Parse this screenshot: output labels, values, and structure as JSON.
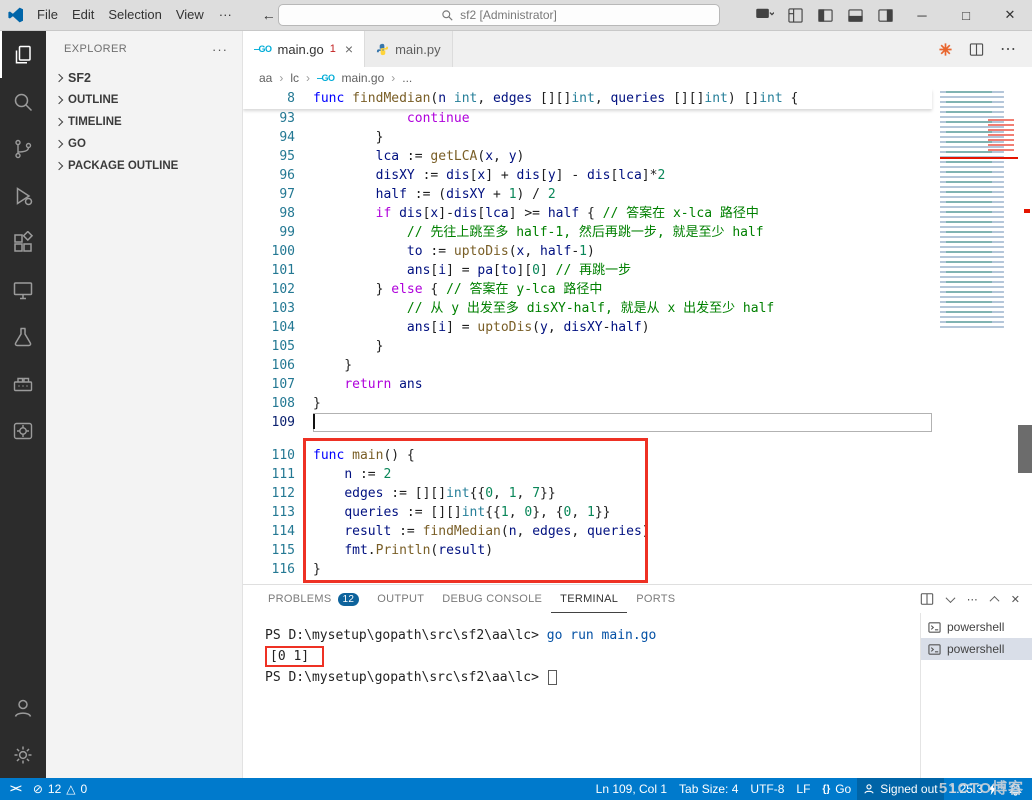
{
  "titlebar": {
    "menus": [
      "File",
      "Edit",
      "Selection",
      "View"
    ],
    "overflow": "···",
    "back": "←",
    "forward": "→",
    "search_label": "sf2 [Administrator]",
    "minimize": "─",
    "maximize": "□",
    "close": "✕"
  },
  "sidebar": {
    "title": "EXPLORER",
    "more": "···",
    "sections": [
      "SF2",
      "OUTLINE",
      "TIMELINE",
      "GO",
      "PACKAGE OUTLINE"
    ]
  },
  "tabs": {
    "tab1": {
      "label": "main.go",
      "badge": "1",
      "close": "×"
    },
    "tab2": {
      "label": "main.py"
    },
    "more": "⋯"
  },
  "breadcrumb": {
    "items": [
      "aa",
      "lc",
      "main.go"
    ],
    "sep": "›",
    "more": "..."
  },
  "editor": {
    "sticky": {
      "num": "8",
      "tokens": [
        [
          "k",
          "func "
        ],
        [
          "f",
          "findMedian"
        ],
        [
          "d",
          "("
        ],
        [
          "v",
          "n"
        ],
        [
          "t",
          " int"
        ],
        [
          "d",
          ", "
        ],
        [
          "v",
          "edges"
        ],
        [
          "d",
          " [][]"
        ],
        [
          "t",
          "int"
        ],
        [
          "d",
          ", "
        ],
        [
          "v",
          "queries"
        ],
        [
          "d",
          " [][]"
        ],
        [
          "t",
          "int"
        ],
        [
          "d",
          ") []"
        ],
        [
          "t",
          "int"
        ],
        [
          "d",
          " {"
        ]
      ]
    },
    "lines": [
      {
        "num": "93",
        "tokens": [
          [
            "d",
            "            "
          ],
          [
            "c",
            "continue"
          ]
        ]
      },
      {
        "num": "94",
        "tokens": [
          [
            "d",
            "        }"
          ]
        ]
      },
      {
        "num": "95",
        "tokens": [
          [
            "d",
            "        "
          ],
          [
            "v",
            "lca"
          ],
          [
            "d",
            " := "
          ],
          [
            "f",
            "getLCA"
          ],
          [
            "d",
            "("
          ],
          [
            "v",
            "x"
          ],
          [
            "d",
            ", "
          ],
          [
            "v",
            "y"
          ],
          [
            "d",
            ")"
          ]
        ]
      },
      {
        "num": "96",
        "tokens": [
          [
            "d",
            "        "
          ],
          [
            "v",
            "disXY"
          ],
          [
            "d",
            " := "
          ],
          [
            "v",
            "dis"
          ],
          [
            "d",
            "["
          ],
          [
            "v",
            "x"
          ],
          [
            "d",
            "] + "
          ],
          [
            "v",
            "dis"
          ],
          [
            "d",
            "["
          ],
          [
            "v",
            "y"
          ],
          [
            "d",
            "] - "
          ],
          [
            "v",
            "dis"
          ],
          [
            "d",
            "["
          ],
          [
            "v",
            "lca"
          ],
          [
            "d",
            "]*"
          ],
          [
            "n",
            "2"
          ]
        ]
      },
      {
        "num": "97",
        "tokens": [
          [
            "d",
            "        "
          ],
          [
            "v",
            "half"
          ],
          [
            "d",
            " := ("
          ],
          [
            "v",
            "disXY"
          ],
          [
            "d",
            " + "
          ],
          [
            "n",
            "1"
          ],
          [
            "d",
            ") / "
          ],
          [
            "n",
            "2"
          ]
        ]
      },
      {
        "num": "98",
        "tokens": [
          [
            "d",
            "        "
          ],
          [
            "c",
            "if"
          ],
          [
            "d",
            " "
          ],
          [
            "v",
            "dis"
          ],
          [
            "d",
            "["
          ],
          [
            "v",
            "x"
          ],
          [
            "d",
            "]-"
          ],
          [
            "v",
            "dis"
          ],
          [
            "d",
            "["
          ],
          [
            "v",
            "lca"
          ],
          [
            "d",
            "] >= "
          ],
          [
            "v",
            "half"
          ],
          [
            "d",
            " { "
          ],
          [
            "m",
            "// 答案在 x-lca 路径中"
          ]
        ]
      },
      {
        "num": "99",
        "tokens": [
          [
            "d",
            "            "
          ],
          [
            "m",
            "// 先往上跳至多 half-1, 然后再跳一步, 就是至少 half"
          ]
        ]
      },
      {
        "num": "100",
        "tokens": [
          [
            "d",
            "            "
          ],
          [
            "v",
            "to"
          ],
          [
            "d",
            " := "
          ],
          [
            "f",
            "uptoDis"
          ],
          [
            "d",
            "("
          ],
          [
            "v",
            "x"
          ],
          [
            "d",
            ", "
          ],
          [
            "v",
            "half"
          ],
          [
            "d",
            "-"
          ],
          [
            "n",
            "1"
          ],
          [
            "d",
            ")"
          ]
        ]
      },
      {
        "num": "101",
        "tokens": [
          [
            "d",
            "            "
          ],
          [
            "v",
            "ans"
          ],
          [
            "d",
            "["
          ],
          [
            "v",
            "i"
          ],
          [
            "d",
            "] = "
          ],
          [
            "v",
            "pa"
          ],
          [
            "d",
            "["
          ],
          [
            "v",
            "to"
          ],
          [
            "d",
            "]["
          ],
          [
            "n",
            "0"
          ],
          [
            "d",
            "] "
          ],
          [
            "m",
            "// 再跳一步"
          ]
        ]
      },
      {
        "num": "102",
        "tokens": [
          [
            "d",
            "        } "
          ],
          [
            "c",
            "else"
          ],
          [
            "d",
            " { "
          ],
          [
            "m",
            "// 答案在 y-lca 路径中"
          ]
        ]
      },
      {
        "num": "103",
        "tokens": [
          [
            "d",
            "            "
          ],
          [
            "m",
            "// 从 y 出发至多 disXY-half, 就是从 x 出发至少 half"
          ]
        ]
      },
      {
        "num": "104",
        "tokens": [
          [
            "d",
            "            "
          ],
          [
            "v",
            "ans"
          ],
          [
            "d",
            "["
          ],
          [
            "v",
            "i"
          ],
          [
            "d",
            "] = "
          ],
          [
            "f",
            "uptoDis"
          ],
          [
            "d",
            "("
          ],
          [
            "v",
            "y"
          ],
          [
            "d",
            ", "
          ],
          [
            "v",
            "disXY"
          ],
          [
            "d",
            "-"
          ],
          [
            "v",
            "half"
          ],
          [
            "d",
            ")"
          ]
        ]
      },
      {
        "num": "105",
        "tokens": [
          [
            "d",
            "        }"
          ]
        ]
      },
      {
        "num": "106",
        "tokens": [
          [
            "d",
            "    }"
          ]
        ]
      },
      {
        "num": "107",
        "tokens": [
          [
            "d",
            "    "
          ],
          [
            "c",
            "return"
          ],
          [
            "d",
            " "
          ],
          [
            "v",
            "ans"
          ]
        ]
      },
      {
        "num": "108",
        "tokens": [
          [
            "d",
            "}"
          ]
        ]
      },
      {
        "num": "109",
        "tokens": [],
        "current": true
      },
      {
        "num": "110",
        "tokens": [
          [
            "k",
            "func "
          ],
          [
            "f",
            "main"
          ],
          [
            "d",
            "() {"
          ]
        ],
        "gap": true
      },
      {
        "num": "111",
        "tokens": [
          [
            "d",
            "    "
          ],
          [
            "v",
            "n"
          ],
          [
            "d",
            " := "
          ],
          [
            "n",
            "2"
          ]
        ]
      },
      {
        "num": "112",
        "tokens": [
          [
            "d",
            "    "
          ],
          [
            "v",
            "edges"
          ],
          [
            "d",
            " := [][]"
          ],
          [
            "t",
            "int"
          ],
          [
            "d",
            "{{"
          ],
          [
            "n",
            "0"
          ],
          [
            "d",
            ", "
          ],
          [
            "n",
            "1"
          ],
          [
            "d",
            ", "
          ],
          [
            "n",
            "7"
          ],
          [
            "d",
            "}}"
          ]
        ]
      },
      {
        "num": "113",
        "tokens": [
          [
            "d",
            "    "
          ],
          [
            "v",
            "queries"
          ],
          [
            "d",
            " := [][]"
          ],
          [
            "t",
            "int"
          ],
          [
            "d",
            "{{"
          ],
          [
            "n",
            "1"
          ],
          [
            "d",
            ", "
          ],
          [
            "n",
            "0"
          ],
          [
            "d",
            "}, {"
          ],
          [
            "n",
            "0"
          ],
          [
            "d",
            ", "
          ],
          [
            "n",
            "1"
          ],
          [
            "d",
            "}}"
          ]
        ]
      },
      {
        "num": "114",
        "tokens": [
          [
            "d",
            "    "
          ],
          [
            "v",
            "result"
          ],
          [
            "d",
            " := "
          ],
          [
            "f",
            "findMedian"
          ],
          [
            "d",
            "("
          ],
          [
            "v",
            "n"
          ],
          [
            "d",
            ", "
          ],
          [
            "v",
            "edges"
          ],
          [
            "d",
            ", "
          ],
          [
            "v",
            "queries"
          ],
          [
            "d",
            ")"
          ]
        ]
      },
      {
        "num": "115",
        "tokens": [
          [
            "d",
            "    "
          ],
          [
            "v",
            "fmt"
          ],
          [
            "d",
            "."
          ],
          [
            "f",
            "Println"
          ],
          [
            "d",
            "("
          ],
          [
            "v",
            "result"
          ],
          [
            "d",
            ")"
          ]
        ]
      },
      {
        "num": "116",
        "tokens": [
          [
            "d",
            "}"
          ]
        ]
      }
    ]
  },
  "panel": {
    "tabs": [
      {
        "label": "PROBLEMS",
        "badge": "12"
      },
      {
        "label": "OUTPUT"
      },
      {
        "label": "DEBUG CONSOLE"
      },
      {
        "label": "TERMINAL"
      },
      {
        "label": "PORTS"
      }
    ],
    "more": "⋯",
    "close": "✕",
    "terminal": {
      "lines": [
        {
          "parts": [
            [
              "prompt",
              "PS D:\\mysetup\\gopath\\src\\sf2\\aa\\lc> "
            ],
            [
              "cmd",
              "go run main.go"
            ]
          ]
        },
        {
          "parts": [
            [
              "out",
              "[0 1]"
            ]
          ],
          "boxed": true
        },
        {
          "parts": [
            [
              "prompt",
              "PS D:\\mysetup\\gopath\\src\\sf2\\aa\\lc> "
            ]
          ],
          "cursor": true
        }
      ]
    },
    "terminal_list": [
      {
        "label": "powershell"
      },
      {
        "label": "powershell",
        "selected": true
      }
    ]
  },
  "statusbar": {
    "remote": "><",
    "errors": "12",
    "warnings": "0",
    "error_icon": "⊘",
    "warning_icon": "△",
    "line_col": "Ln 109, Col 1",
    "tab_size": "Tab Size: 4",
    "encoding": "UTF-8",
    "eol": "LF",
    "lang_icon": "{}",
    "lang": "Go",
    "account": "Signed out",
    "go_version": "1.25.3"
  },
  "watermark": "51CTO博客"
}
